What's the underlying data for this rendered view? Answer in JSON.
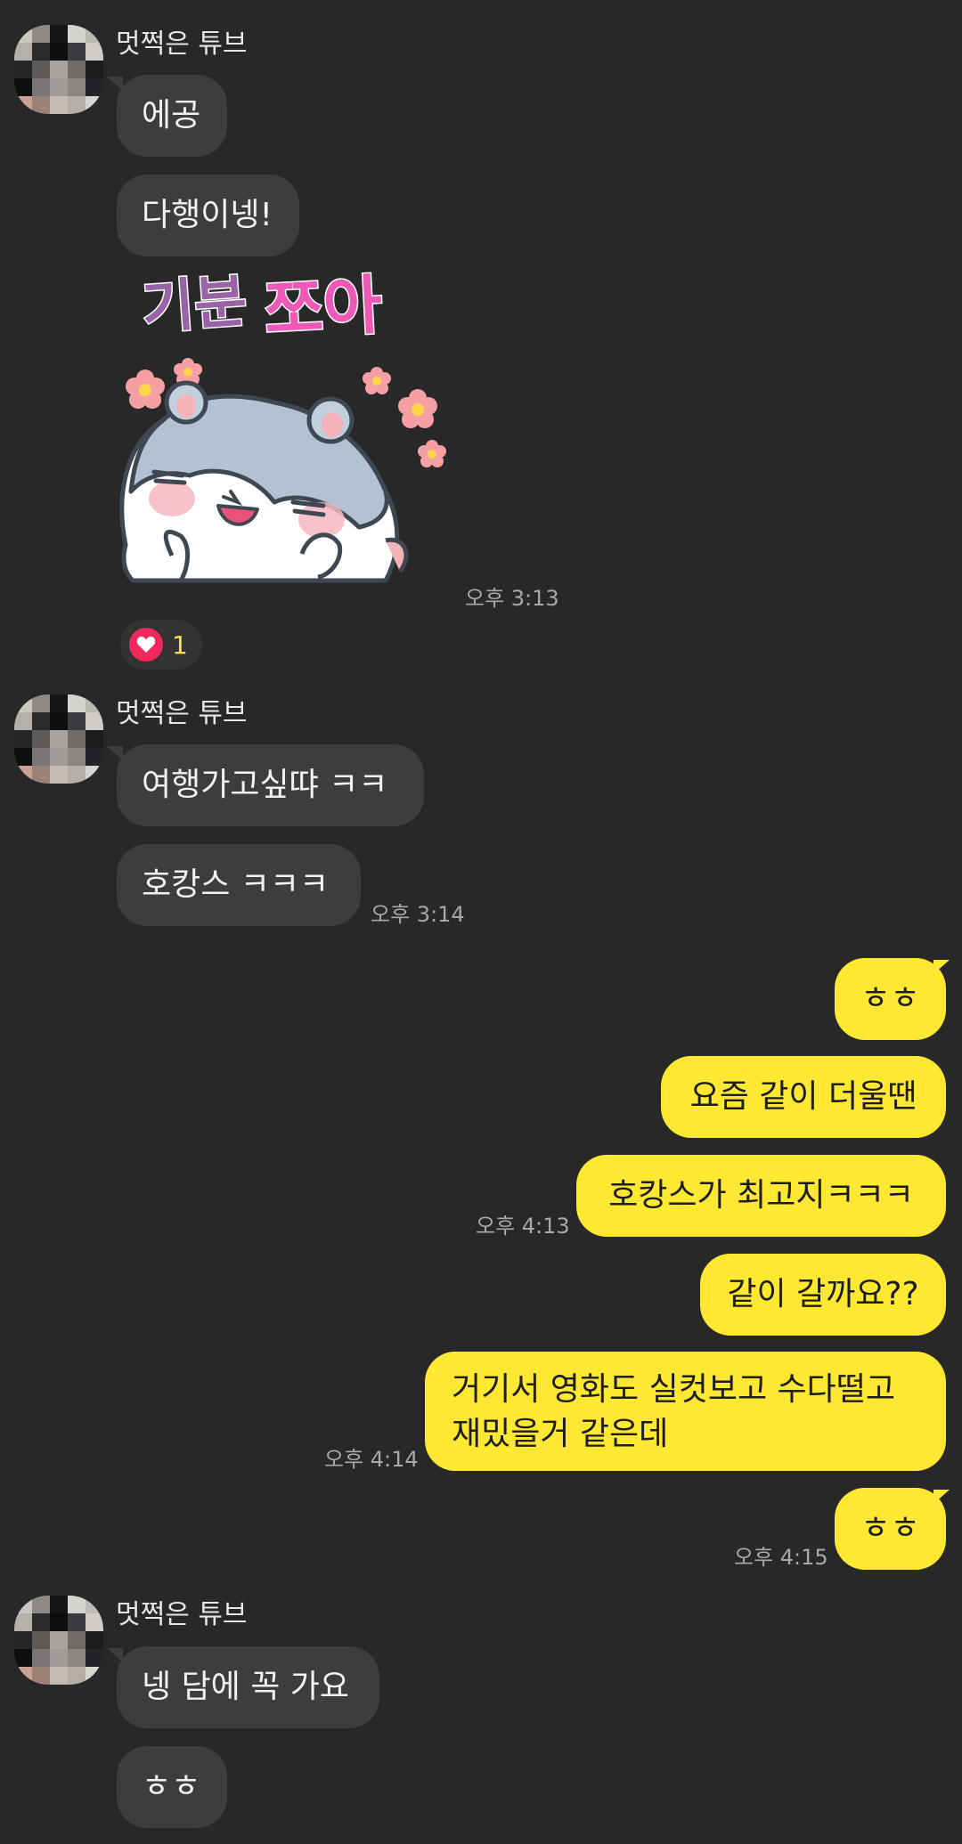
{
  "colors": {
    "background": "#282828",
    "received_bubble": "#3d3d3d",
    "sent_bubble": "#fee832",
    "reaction_heart": "#f0285e"
  },
  "sender_name": "멋쩍은 튜브",
  "groups": [
    {
      "messages": [
        "에공",
        "다행이넹!"
      ],
      "sticker": {
        "caption": "기분",
        "caption_accent": "쪼아",
        "description": "hamster sticker"
      },
      "time": "오후 3:13",
      "reaction": {
        "icon": "heart-icon",
        "count": "1"
      }
    },
    {
      "messages": [
        "여행가고싶땨 ㅋㅋ",
        "호캉스 ㅋㅋㅋ"
      ],
      "time": "오후 3:14"
    },
    {
      "messages": [
        "넹 담에 꼭 가요",
        "ㅎㅎ"
      ]
    }
  ],
  "sent": [
    {
      "text": "ㅎㅎ"
    },
    {
      "text": "요즘 같이 더울땐"
    },
    {
      "text": "호캉스가 최고지ㅋㅋㅋ",
      "time": "오후 4:13"
    },
    {
      "text": "같이 갈까요??"
    },
    {
      "lines": [
        "거기서 영화도 실컷보고 수다떨고",
        "재밌을거 같은데"
      ],
      "time": "오후 4:14"
    },
    {
      "text": "ㅎㅎ",
      "time": "오후 4:15"
    }
  ]
}
